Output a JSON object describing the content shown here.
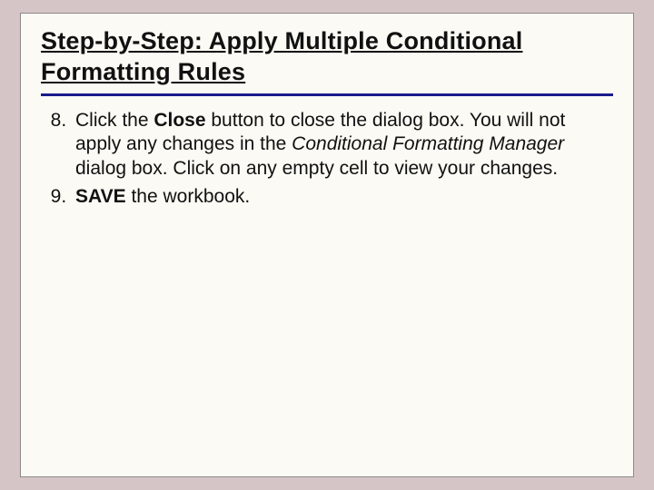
{
  "title": "Step-by-Step: Apply Multiple Conditional Formatting Rules",
  "list": {
    "start": 8,
    "items": [
      {
        "segments": [
          {
            "text": "Click the "
          },
          {
            "text": "Close",
            "bold": true
          },
          {
            "text": " button to close the dialog box. You will not apply any changes in the "
          },
          {
            "text": "Conditional Formatting Manager",
            "italic": true
          },
          {
            "text": " dialog box. Click on any empty cell to view your changes."
          }
        ]
      },
      {
        "segments": [
          {
            "text": "SAVE",
            "bold": true
          },
          {
            "text": " the workbook."
          }
        ]
      }
    ]
  }
}
